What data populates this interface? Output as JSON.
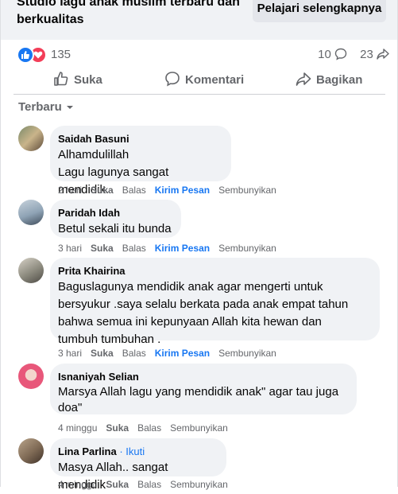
{
  "banner": {
    "title": "Studio lagu anak muslim terbaru dan berkualitas",
    "learn_more": "Pelajari selengkapnya"
  },
  "reactions": {
    "count": "135",
    "comments_count": "10",
    "shares_count": "23",
    "like_color": "#1877f2",
    "love_color": "#f33e58"
  },
  "actions": {
    "like": "Suka",
    "comment": "Komentari",
    "share": "Bagikan"
  },
  "sort_label": "Terbaru",
  "comments": [
    {
      "author": "Saidah Basuni",
      "text": "Alhamdulillah\nLagu lagunya sangat mendidik.",
      "time": "2 hari",
      "like": "Suka",
      "reply": "Balas",
      "message": "Kirim Pesan",
      "hide": "Sembunyikan"
    },
    {
      "author": "Paridah Idah",
      "text": "Betul sekali itu bunda",
      "time": "3 hari",
      "like": "Suka",
      "reply": "Balas",
      "message": "Kirim Pesan",
      "hide": "Sembunyikan"
    },
    {
      "author": "Prita Khairina",
      "text": "Baguslagunya mendidik anak agar mengerti untuk\nbersyukur .saya selalu berkata pada anak empat tahun\nbahwa semua ini kepunyaan Allah kita hewan dan\ntumbuh tumbuhan .",
      "time": "3 hari",
      "like": "Suka",
      "reply": "Balas",
      "message": "Kirim Pesan",
      "hide": "Sembunyikan"
    },
    {
      "author": "Isnaniyah Selian",
      "text": "Marsya Allah lagu yang mendidik anak\" agar tau juga\ndoa\"",
      "time": "4 minggu",
      "like": "Suka",
      "reply": "Balas",
      "hide": "Sembunyikan"
    },
    {
      "author": "Lina Parlina",
      "follow": "· Ikuti",
      "text": "Masya Allah.. sangat mendidik",
      "time": "4 minggu",
      "like": "Suka",
      "reply": "Balas",
      "hide": "Sembunyikan"
    }
  ]
}
